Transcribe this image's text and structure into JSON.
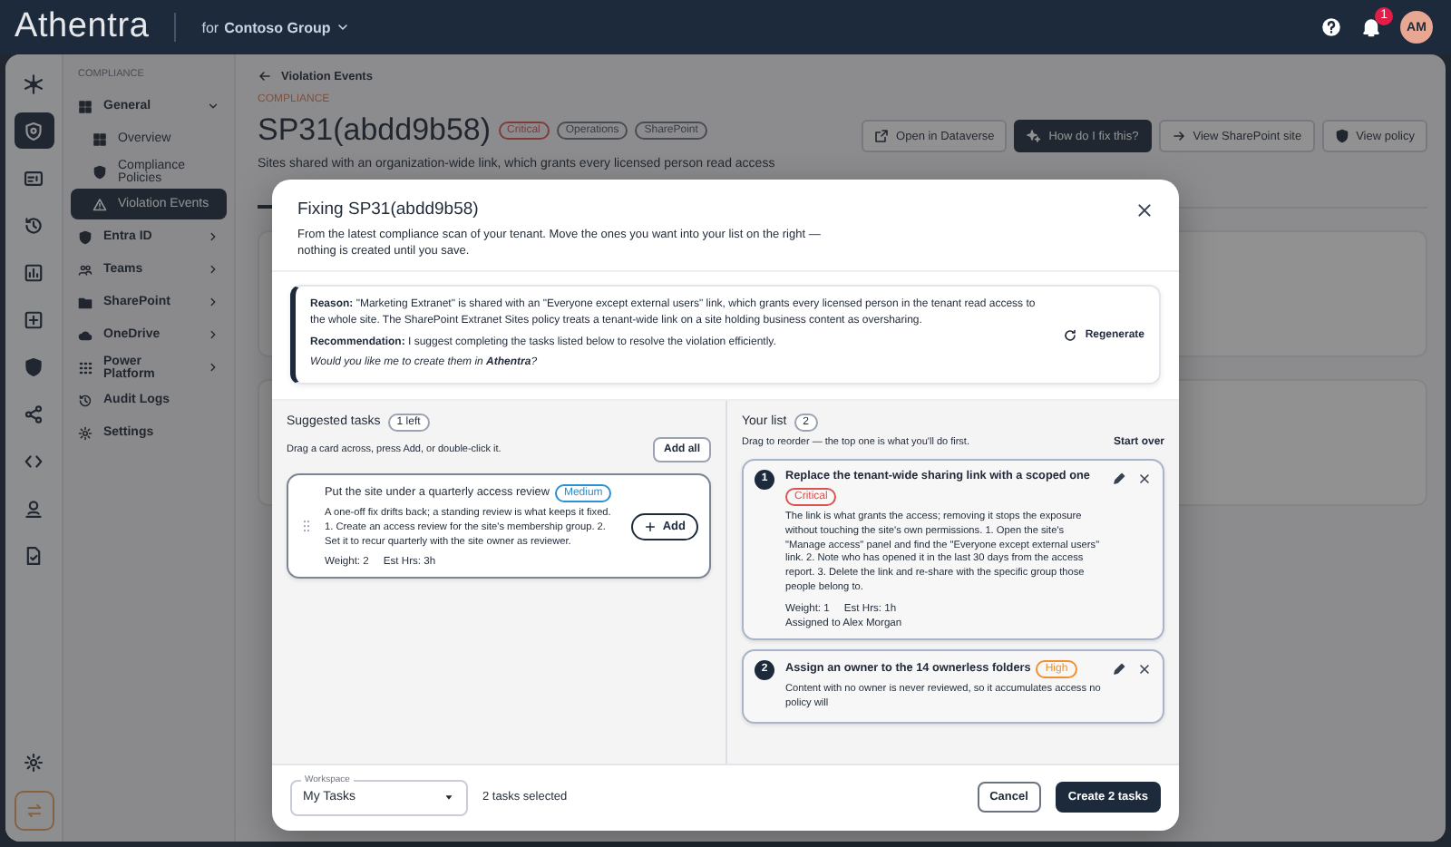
{
  "header": {
    "brand": "Athentra",
    "tenant_prefix": "for",
    "tenant": "Contoso Group",
    "notification_count": "1",
    "avatar_initials": "AM"
  },
  "rail": [
    {
      "selected": false
    },
    {
      "selected": true
    },
    {
      "selected": false
    },
    {
      "selected": false
    },
    {
      "selected": false
    },
    {
      "selected": false
    },
    {
      "selected": false
    },
    {
      "selected": false
    },
    {
      "selected": false
    },
    {
      "selected": false
    },
    {
      "selected": false
    }
  ],
  "nav": {
    "section": "COMPLIANCE",
    "items": [
      {
        "label": "General",
        "kind": "group",
        "expanded": true,
        "children": [
          {
            "label": "Overview",
            "selected": false
          },
          {
            "label": "Compliance Policies",
            "selected": false
          },
          {
            "label": "Violation Events",
            "selected": true
          }
        ]
      },
      {
        "label": "Entra ID",
        "kind": "group",
        "expanded": false
      },
      {
        "label": "Teams",
        "kind": "group",
        "expanded": false
      },
      {
        "label": "SharePoint",
        "kind": "group",
        "expanded": false
      },
      {
        "label": "OneDrive",
        "kind": "group",
        "expanded": false
      },
      {
        "label": "Power Platform",
        "kind": "group",
        "expanded": false
      },
      {
        "label": "Audit Logs",
        "kind": "link"
      },
      {
        "label": "Settings",
        "kind": "link"
      }
    ]
  },
  "page": {
    "breadcrumb": "Violation Events",
    "eyebrow": "COMPLIANCE",
    "title": "SP31(abdd9b58)",
    "tags": [
      {
        "label": "Critical",
        "kind": "severity"
      },
      {
        "label": "Operations",
        "kind": "category"
      },
      {
        "label": "SharePoint",
        "kind": "category"
      }
    ],
    "subtitle": "Sites shared with an organization-wide link, which grants every licensed person read access",
    "actions": [
      {
        "label": "Open in Dataverse",
        "kind": "outline"
      },
      {
        "label": "How do I fix this?",
        "kind": "primary"
      },
      {
        "label": "View SharePoint site",
        "kind": "outline"
      },
      {
        "label": "View policy",
        "kind": "outline"
      }
    ]
  },
  "modal": {
    "title": "Fixing SP31(abdd9b58)",
    "description": "From the latest compliance scan of your tenant. Move the ones you want into your list on the right — nothing is created until you save.",
    "reason_label": "Reason:",
    "reason": "\"Marketing Extranet\" is shared with an \"Everyone except external users\" link, which grants every licensed person in the tenant read access to the whole site. The SharePoint Extranet Sites policy treats a tenant-wide link on a site holding business content as oversharing.",
    "recommendation_label": "Recommendation:",
    "recommendation": "I suggest completing the tasks listed below to resolve the violation efficiently.",
    "question": "Would you like me to create them in **Athentra**?",
    "regenerate": "Regenerate",
    "suggested": {
      "title": "Suggested tasks",
      "count": "1 left",
      "hint": "Drag a card across, press Add, or double-click it.",
      "add_all": "Add all",
      "tasks": [
        {
          "title": "Put the site under a quarterly access review",
          "priority": {
            "label": "Medium",
            "color": "#2b8fd6"
          },
          "description": "A one-off fix drifts back; a standing review is what keeps it fixed. 1. Create an access review for the site's membership group. 2. Set it to recur quarterly with the site owner as reviewer.",
          "weight": "Weight: 2",
          "hours": "Est Hrs: 3h",
          "add": "Add"
        }
      ]
    },
    "list": {
      "title": "Your list",
      "count": "2",
      "hint": "Drag to reorder — the top one is what you'll do first.",
      "start_over": "Start over",
      "items": [
        {
          "number": "1",
          "title": "Replace the tenant-wide sharing link with a scoped one",
          "priority": {
            "label": "Critical",
            "color": "#d9534f"
          },
          "description": "The link is what grants the access; removing it stops the exposure without touching the site's own permissions. 1. Open the site's \"Manage access\" panel and find the \"Everyone except external users\" link. 2. Note who has opened it in the last 30 days from the access report. 3. Delete the link and re-share with the specific group those people belong to.",
          "weight": "Weight: 1",
          "hours": "Est Hrs: 1h",
          "assignee": "Assigned to Alex Morgan"
        },
        {
          "number": "2",
          "title": "Assign an owner to the 14 ownerless folders",
          "priority": {
            "label": "High",
            "color": "#f0902a"
          },
          "description": "Content with no owner is never reviewed, so it accumulates access no policy will"
        }
      ]
    },
    "footer": {
      "workspace_label": "Workspace",
      "workspace": "My Tasks",
      "selected_count": "2 tasks selected",
      "cancel": "Cancel",
      "create": "Create 2 tasks"
    }
  }
}
